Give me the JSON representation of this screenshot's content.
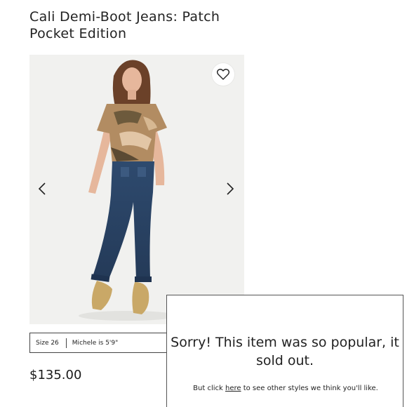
{
  "product": {
    "title": "Cali Demi-Boot Jeans: Patch Pocket Edition",
    "price": "$135.00",
    "size_label": "Size 26",
    "model_info": "Michele is 5'9\""
  },
  "gallery": {
    "background": "#f1f1ef",
    "image_subject": "model wearing camo t-shirt, demi-boot jeans and gold shoes",
    "favorite_icon": "heart-icon",
    "prev_icon": "chevron-left-icon",
    "next_icon": "chevron-right-icon"
  },
  "soldout": {
    "heading": "Sorry! This item was so popular, it sold out.",
    "body_prefix": "But click ",
    "link": "here",
    "body_suffix": " to see other styles we think you'll like."
  }
}
